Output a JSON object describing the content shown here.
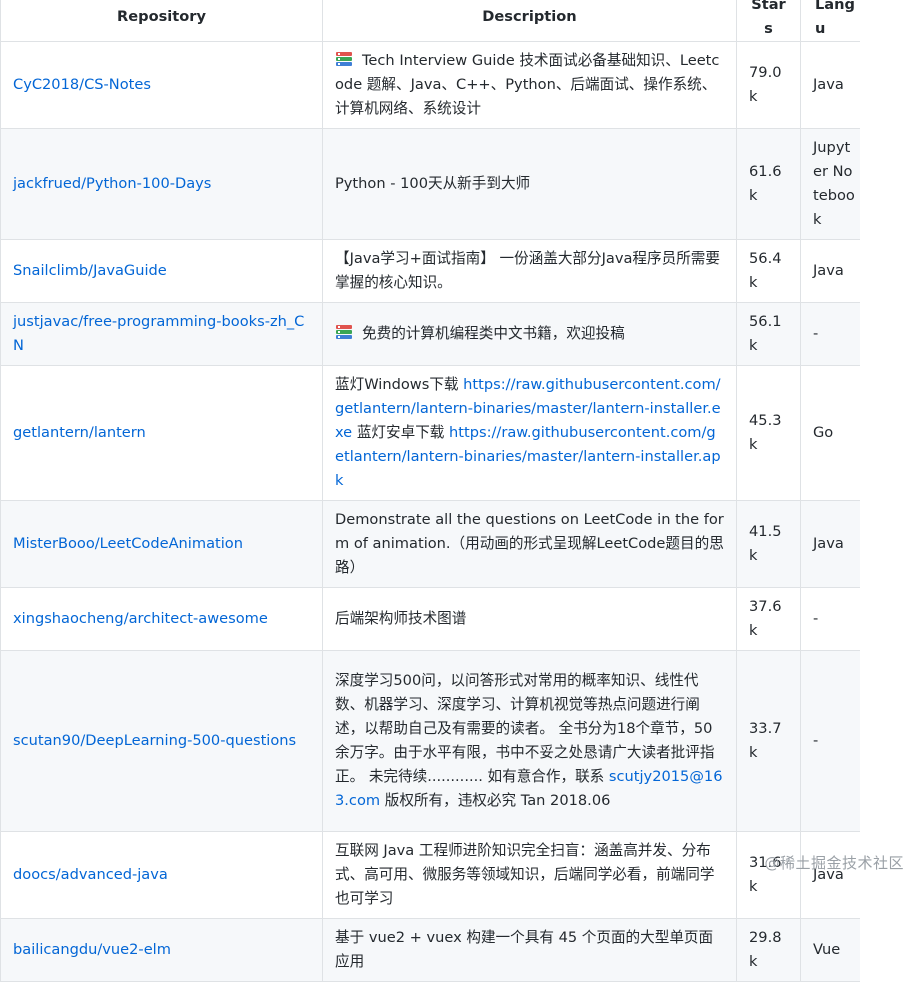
{
  "table": {
    "headers": [
      "Repository",
      "Description",
      "Stars",
      "Langu"
    ],
    "rows": [
      {
        "repo": "CyC2018/CS-Notes",
        "icon": "books-icon",
        "description": "Tech Interview Guide 技术面试必备基础知识、Leetcode 题解、Java、C++、Python、后端面试、操作系统、计算机网络、系统设计",
        "stars": "79.0k",
        "language": "Java"
      },
      {
        "repo": "jackfrued/Python-100-Days",
        "description": "Python - 100天从新手到大师",
        "stars": "61.6k",
        "language": "Jupyter Notebook"
      },
      {
        "repo": "Snailclimb/JavaGuide",
        "description": "【Java学习+面试指南】 一份涵盖大部分Java程序员所需要掌握的核心知识。",
        "stars": "56.4k",
        "language": "Java"
      },
      {
        "repo": "justjavac/free-programming-books-zh_CN",
        "icon": "books-icon",
        "description": "免费的计算机编程类中文书籍，欢迎投稿",
        "stars": "56.1k",
        "language": "-"
      },
      {
        "repo": "getlantern/lantern",
        "description_parts": [
          "蓝灯Windows下载",
          "https://raw.githubusercontent.com/getlantern/lantern-binaries/master/lantern-installer.exe",
          "蓝灯安卓下载",
          "https://raw.githubusercontent.com/getlantern/lantern-binaries/master/lantern-installer.apk"
        ],
        "stars": "45.3k",
        "language": "Go"
      },
      {
        "repo": "MisterBooo/LeetCodeAnimation",
        "description": "Demonstrate all the questions on LeetCode in the form of animation.（用动画的形式呈现解LeetCode题目的思路）",
        "stars": "41.5k",
        "language": "Java"
      },
      {
        "repo": "xingshaocheng/architect-awesome",
        "description": "后端架构师技术图谱",
        "stars": "37.6k",
        "language": "-"
      },
      {
        "repo": "scutan90/DeepLearning-500-questions",
        "description_parts": [
          "深度学习500问，以问答形式对常用的概率知识、线性代数、机器学习、深度学习、计算机视觉等热点问题进行阐述，以帮助自己及有需要的读者。 全书分为18个章节，50余万字。由于水平有限，书中不妥之处恳请广大读者批评指正。 未完待续............ 如有意合作，联系 ",
          "scutjy2015@163.com",
          " 版权所有，违权必究 Tan 2018.06"
        ],
        "stars": "33.7k",
        "language": "-"
      },
      {
        "repo": "doocs/advanced-java",
        "description": "互联网 Java 工程师进阶知识完全扫盲：涵盖高并发、分布式、高可用、微服务等领域知识，后端同学必看，前端同学也可学习",
        "stars": "31.6k",
        "language": "Java"
      },
      {
        "repo": "bailicangdu/vue2-elm",
        "description": "基于 vue2 + vuex 构建一个具有 45 个页面的大型单页面应用",
        "stars": "29.8k",
        "language": "Vue"
      }
    ]
  },
  "watermark": "@稀土掘金技术社区"
}
